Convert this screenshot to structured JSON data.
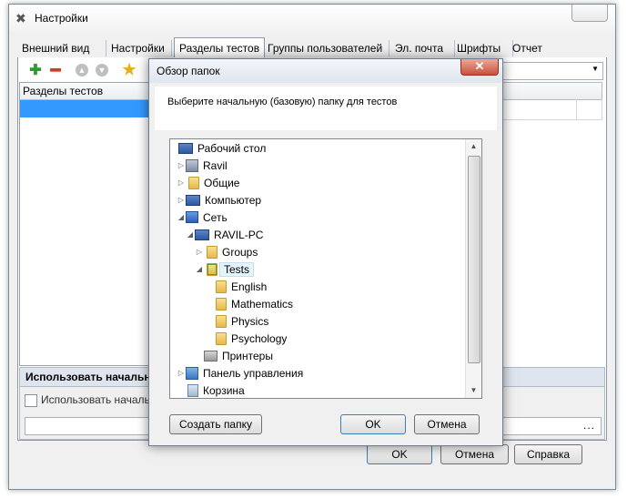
{
  "main_window": {
    "title": "Настройки",
    "tabs": [
      {
        "label": "Внешний вид"
      },
      {
        "label": "Настройки"
      },
      {
        "label": "Разделы тестов"
      },
      {
        "label": "Группы пользователей"
      },
      {
        "label": "Эл. почта"
      },
      {
        "label": "Шрифты"
      },
      {
        "label": "Отчет"
      }
    ],
    "active_tab": "Разделы тестов",
    "toolbar_icons": [
      "add-icon",
      "remove-icon",
      "move-up-icon",
      "move-down-icon",
      "star-icon"
    ],
    "grid_header": "Разделы тестов",
    "bottom_group_title": "Использовать начальну",
    "use_checkbox_label": "Использовать начальн",
    "path_button": "...",
    "buttons": {
      "ok": "OK",
      "cancel": "Отмена",
      "help": "Справка"
    }
  },
  "dialog": {
    "title": "Обзор папок",
    "close_glyph": "✕",
    "description": "Выберите начальную (базовую) папку для тестов",
    "tree": [
      {
        "label": "Рабочий стол",
        "icon": "desktop-icon",
        "expander": ""
      },
      {
        "label": "Ravil",
        "icon": "user-folder-icon",
        "expander": "▷"
      },
      {
        "label": "Общие",
        "icon": "folder-icon",
        "expander": "▷"
      },
      {
        "label": "Компьютер",
        "icon": "computer-icon",
        "expander": "▷"
      },
      {
        "label": "Сеть",
        "icon": "network-icon",
        "expander": "◢"
      },
      {
        "label": "RAVIL-PC",
        "icon": "computer-icon",
        "expander": "◢"
      },
      {
        "label": "Groups",
        "icon": "shared-folder-icon",
        "expander": "▷"
      },
      {
        "label": "Tests",
        "icon": "shared-folder-icon",
        "expander": "◢",
        "selected": true
      },
      {
        "label": "English",
        "icon": "folder-icon",
        "expander": ""
      },
      {
        "label": "Mathematics",
        "icon": "folder-icon",
        "expander": ""
      },
      {
        "label": "Physics",
        "icon": "folder-icon",
        "expander": ""
      },
      {
        "label": "Psychology",
        "icon": "folder-icon",
        "expander": ""
      },
      {
        "label": "Принтеры",
        "icon": "printer-icon",
        "expander": ""
      },
      {
        "label": "Панель управления",
        "icon": "control-panel-icon",
        "expander": "▷"
      },
      {
        "label": "Корзина",
        "icon": "recycle-bin-icon",
        "expander": ""
      }
    ],
    "buttons": {
      "new_folder": "Создать папку",
      "ok": "OK",
      "cancel": "Отмена"
    }
  },
  "colors": {
    "selection": "#3399ff",
    "accent_green": "#2e9b2e",
    "accent_red": "#d23a2a"
  }
}
